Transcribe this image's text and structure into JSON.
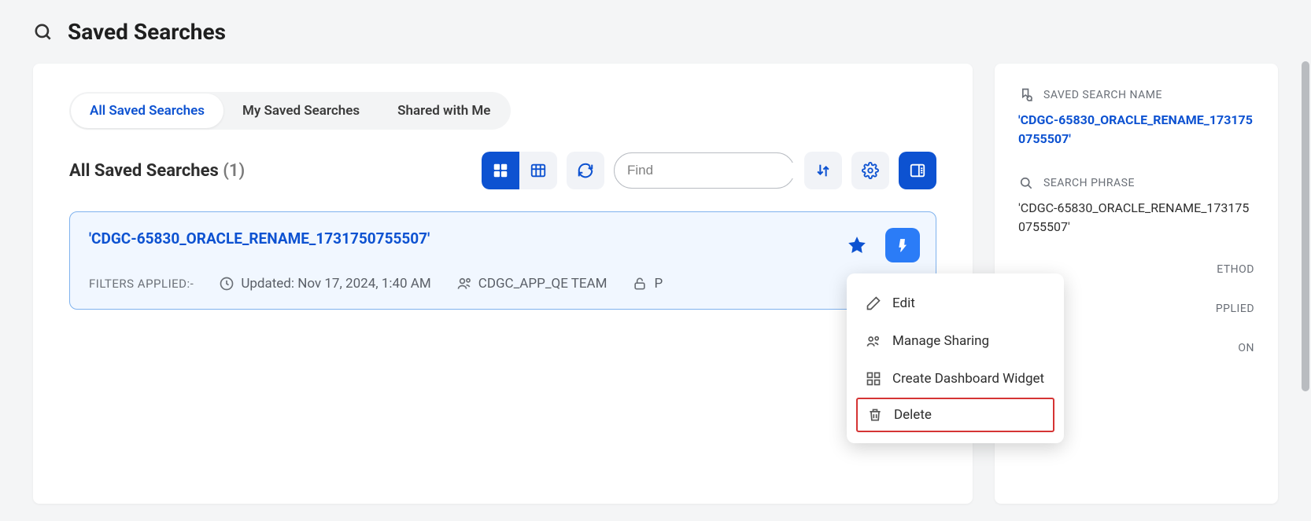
{
  "header": {
    "title": "Saved Searches"
  },
  "tabs": {
    "all": "All Saved Searches",
    "mine": "My Saved Searches",
    "shared": "Shared with Me"
  },
  "listing": {
    "title": "All Saved Searches",
    "count": "(1)"
  },
  "search": {
    "placeholder": "Find"
  },
  "result": {
    "name": "'CDGC-65830_ORACLE_RENAME_1731750755507'",
    "filters_label": "FILTERS APPLIED:-",
    "updated": "Updated: Nov 17, 2024, 1:40 AM",
    "owner": "CDGC_APP_QE TEAM",
    "access_prefix": "P"
  },
  "menu": {
    "edit": "Edit",
    "share": "Manage Sharing",
    "widget": "Create Dashboard Widget",
    "delete": "Delete"
  },
  "panel": {
    "name_label": "SAVED SEARCH NAME",
    "name_value": "'CDGC-65830_ORACLE_RENAME_1731750755507'",
    "phrase_label": "SEARCH PHRASE",
    "phrase_value": "'CDGC-65830_ORACLE_RENAME_1731750755507'",
    "method_label_fragment": "ETHOD",
    "applied_label_fragment": "PPLIED",
    "on_label_fragment": "ON",
    "dash": "-"
  }
}
